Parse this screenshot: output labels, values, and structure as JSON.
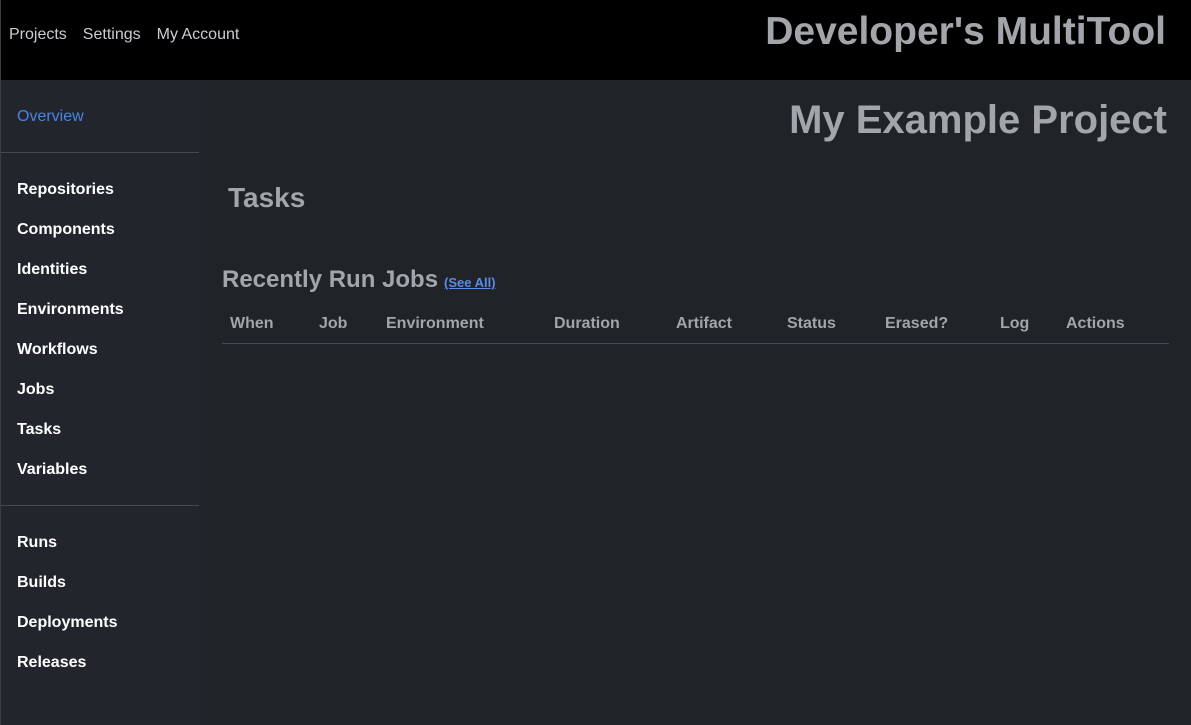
{
  "topbar": {
    "nav": [
      "Projects",
      "Settings",
      "My Account"
    ],
    "app_title": "Developer's MultiTool"
  },
  "sidebar": {
    "overview": "Overview",
    "group1": [
      "Repositories",
      "Components",
      "Identities",
      "Environments",
      "Workflows",
      "Jobs",
      "Tasks",
      "Variables"
    ],
    "group2": [
      "Runs",
      "Builds",
      "Deployments",
      "Releases"
    ]
  },
  "main": {
    "project_title": "My Example Project",
    "section_title": "Tasks",
    "jobs": {
      "title": "Recently Run Jobs",
      "see_all": "(See All)",
      "columns": [
        "When",
        "Job",
        "Environment",
        "Duration",
        "Artifact",
        "Status",
        "Erased?",
        "Log",
        "Actions"
      ],
      "rows": []
    }
  },
  "colors": {
    "topbar_bg": "#000000",
    "page_bg": "#22262c",
    "active_link": "#4a82e6",
    "heading": "#a2a5aa"
  }
}
